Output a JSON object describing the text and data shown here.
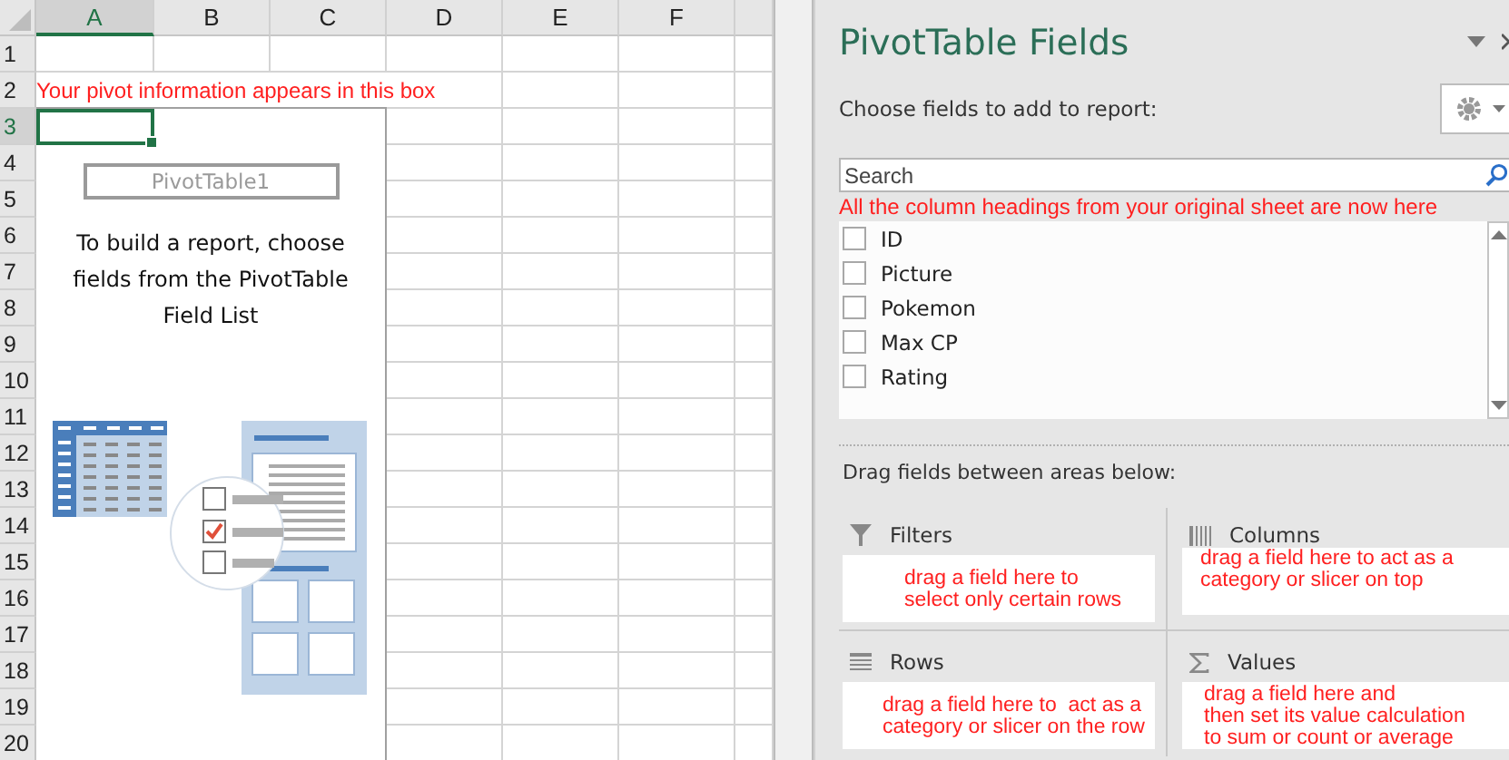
{
  "sheet": {
    "columns": [
      {
        "label": "A",
        "selected": true
      },
      {
        "label": "B",
        "selected": false
      },
      {
        "label": "C",
        "selected": false
      },
      {
        "label": "D",
        "selected": false
      },
      {
        "label": "E",
        "selected": false
      },
      {
        "label": "F",
        "selected": false
      }
    ],
    "rows": [
      {
        "label": "1",
        "selected": false
      },
      {
        "label": "2",
        "selected": false
      },
      {
        "label": "3",
        "selected": true
      },
      {
        "label": "4",
        "selected": false
      },
      {
        "label": "5",
        "selected": false
      },
      {
        "label": "6",
        "selected": false
      },
      {
        "label": "7",
        "selected": false
      },
      {
        "label": "8",
        "selected": false
      },
      {
        "label": "9",
        "selected": false
      },
      {
        "label": "10",
        "selected": false
      },
      {
        "label": "11",
        "selected": false
      },
      {
        "label": "12",
        "selected": false
      },
      {
        "label": "13",
        "selected": false
      },
      {
        "label": "14",
        "selected": false
      },
      {
        "label": "15",
        "selected": false
      },
      {
        "label": "16",
        "selected": false
      },
      {
        "label": "17",
        "selected": false
      },
      {
        "label": "18",
        "selected": false
      },
      {
        "label": "19",
        "selected": false
      },
      {
        "label": "20",
        "selected": false
      }
    ],
    "annotation": "Your pivot information appears in this box",
    "placeholder": {
      "name": "PivotTable1",
      "instructions": "To build a report, choose fields from the PivotTable Field List"
    }
  },
  "pane": {
    "title": "PivotTable Fields",
    "choose_label": "Choose fields to add to report:",
    "search": {
      "placeholder": "Search"
    },
    "annotation": "All the column headings from your original sheet are now here",
    "fields": [
      {
        "label": "ID",
        "checked": false
      },
      {
        "label": "Picture",
        "checked": false
      },
      {
        "label": "Pokemon",
        "checked": false
      },
      {
        "label": "Max CP",
        "checked": false
      },
      {
        "label": "Rating",
        "checked": false
      }
    ],
    "drag_label": "Drag fields between areas below:",
    "areas": [
      {
        "kind": "filters",
        "label": "Filters",
        "note": [
          "drag a field here to",
          "select only certain rows"
        ]
      },
      {
        "kind": "columns",
        "label": "Columns",
        "note": [
          "drag a field here to act as a",
          "category or slicer on top"
        ]
      },
      {
        "kind": "rows",
        "label": "Rows",
        "note": [
          "drag a field here to  act as a",
          "category or slicer on the row"
        ]
      },
      {
        "kind": "values",
        "label": "Values",
        "note": [
          "drag a field here and",
          "then set its value calculation",
          "to sum or count or average"
        ]
      }
    ]
  }
}
